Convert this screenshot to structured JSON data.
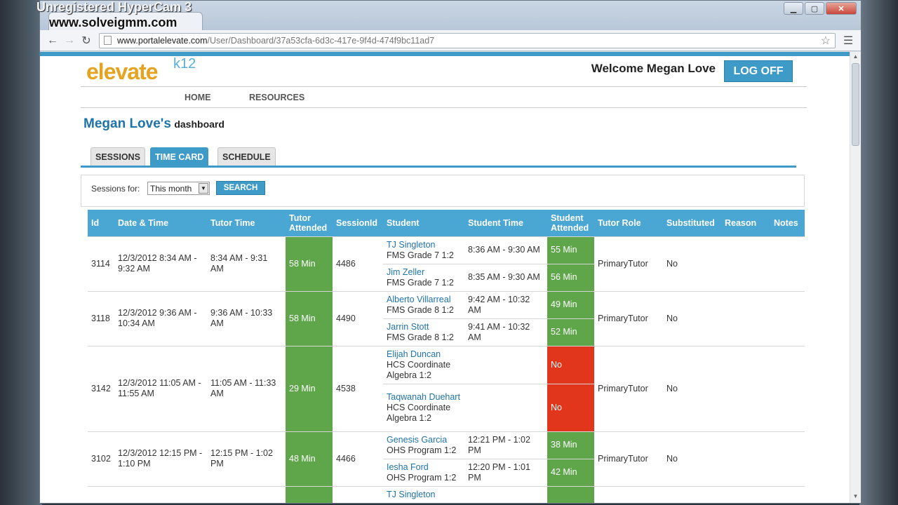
{
  "watermark": "Unregistered HyperCam 3",
  "watermark2": "www.solveigmm.com",
  "browser": {
    "tab_title": "",
    "url_host": "www.portalelevate.com",
    "url_path": "/User/Dashboard/37a53cfa-6d3c-417e-9f4d-474f9bc11ad7"
  },
  "site": {
    "logo": "elevate",
    "logo_sup": "k12",
    "welcome": "Welcome Megan Love",
    "logoff": "LOG OFF",
    "nav": [
      "HOME",
      "RESOURCES"
    ],
    "dash_name": "Megan Love's",
    "dash_sub": "dashboard",
    "tabs": [
      "SESSIONS",
      "TIME CARD",
      "SCHEDULE"
    ],
    "active_tab": "TIME CARD",
    "filter_label": "Sessions for:",
    "filter_value": "This month",
    "search": "SEARCH"
  },
  "table": {
    "headers": [
      "Id",
      "Date & Time",
      "Tutor Time",
      "Tutor Attended",
      "SessionId",
      "Student",
      "Student Time",
      "Student Attended",
      "Tutor Role",
      "Substituted",
      "Reason",
      "Notes"
    ],
    "rows": [
      {
        "id": "3114",
        "date": "12/3/2012 8:34 AM - 9:32 AM",
        "tutor_time": "8:34 AM - 9:31 AM",
        "tutor_attended": "58 Min",
        "session": "4486",
        "role": "PrimaryTutor",
        "sub": "No",
        "students": [
          {
            "name": "TJ Singleton",
            "course": "FMS Grade 7 1:2",
            "time": "8:36 AM - 9:30 AM",
            "attended": "55 Min",
            "status": "green"
          },
          {
            "name": "Jim Zeller",
            "course": "FMS Grade 7 1:2",
            "time": "8:35 AM - 9:30 AM",
            "attended": "56 Min",
            "status": "green"
          }
        ]
      },
      {
        "id": "3118",
        "date": "12/3/2012 9:36 AM - 10:34 AM",
        "tutor_time": "9:36 AM - 10:33 AM",
        "tutor_attended": "58 Min",
        "session": "4490",
        "role": "PrimaryTutor",
        "sub": "No",
        "students": [
          {
            "name": "Alberto Villarreal",
            "course": "FMS Grade 8 1:2",
            "time": "9:42 AM - 10:32 AM",
            "attended": "49 Min",
            "status": "green"
          },
          {
            "name": "Jarrin Stott",
            "course": "FMS Grade 8 1:2",
            "time": "9:41 AM - 10:32 AM",
            "attended": "52 Min",
            "status": "green"
          }
        ]
      },
      {
        "id": "3142",
        "date": "12/3/2012 11:05 AM - 11:55 AM",
        "tutor_time": "11:05 AM - 11:33 AM",
        "tutor_attended": "29 Min",
        "session": "4538",
        "role": "PrimaryTutor",
        "sub": "No",
        "students": [
          {
            "name": "Elijah Duncan",
            "course": "HCS Coordinate Algebra 1:2",
            "time": "",
            "attended": "No",
            "status": "red"
          },
          {
            "name": "Taqwanah Duehart",
            "course": "HCS Coordinate Algebra 1:2",
            "time": "",
            "attended": "No",
            "status": "red"
          }
        ]
      },
      {
        "id": "3102",
        "date": "12/3/2012 12:15 PM - 1:10 PM",
        "tutor_time": "12:15 PM - 1:02 PM",
        "tutor_attended": "48 Min",
        "session": "4466",
        "role": "PrimaryTutor",
        "sub": "No",
        "students": [
          {
            "name": "Genesis Garcia",
            "course": "OHS Program 1:2",
            "time": "12:21 PM - 1:02 PM",
            "attended": "38 Min",
            "status": "green"
          },
          {
            "name": "Iesha Ford",
            "course": "OHS Program 1:2",
            "time": "12:20 PM - 1:01 PM",
            "attended": "42 Min",
            "status": "green"
          }
        ]
      }
    ],
    "partial_next_student": "TJ Singleton"
  }
}
